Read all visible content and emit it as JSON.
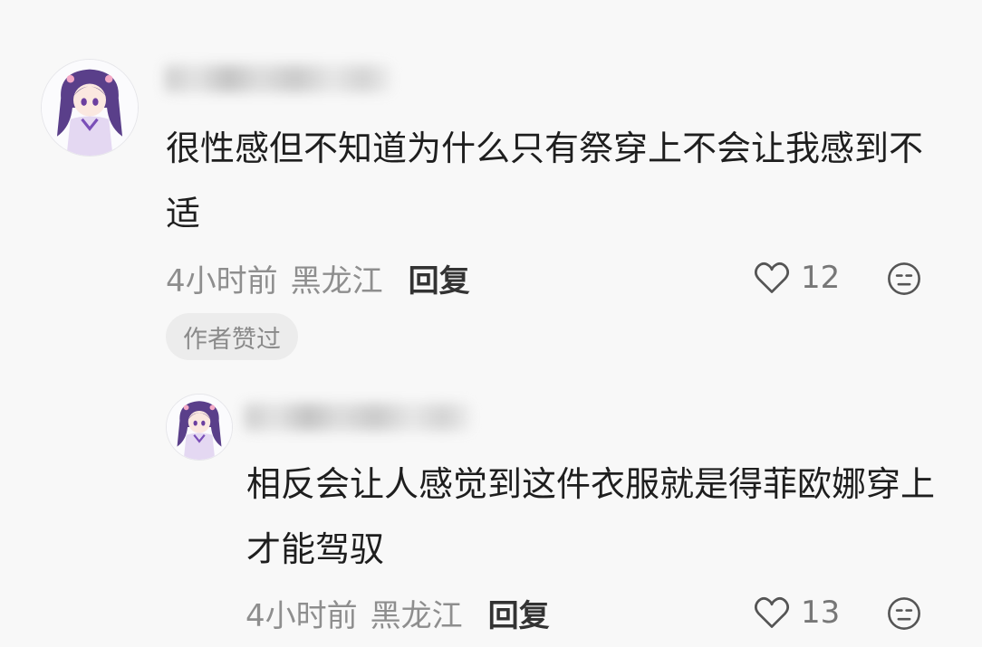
{
  "comments": [
    {
      "text": "很性感但不知道为什么只有祭穿上不会让我感到不适",
      "time": "4小时前",
      "location": "黑龙江",
      "reply_label": "回复",
      "likes": "12",
      "badge": "作者赞过"
    },
    {
      "text": "相反会让人感觉到这件衣服就是得菲欧娜穿上才能驾驭",
      "time": "4小时前",
      "location": "黑龙江",
      "reply_label": "回复",
      "likes": "13"
    }
  ],
  "icons": {
    "like": "heart-outline-icon",
    "dislike": "neutral-face-icon"
  },
  "colors": {
    "background": "#f8f8f8",
    "text": "#1e1e1e",
    "meta": "#8e8e8e",
    "badge_bg": "#ececec"
  }
}
